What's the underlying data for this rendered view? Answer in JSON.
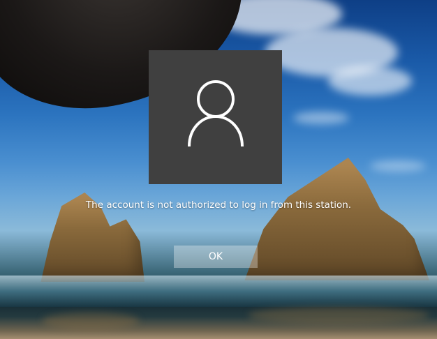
{
  "dialog": {
    "message": "The account is not authorized to log in from this station.",
    "ok_label": "OK"
  },
  "icons": {
    "user_avatar": "user-icon"
  },
  "colors": {
    "avatar_background": "#404040",
    "button_background": "#ffffff55",
    "text": "#ffffff"
  }
}
